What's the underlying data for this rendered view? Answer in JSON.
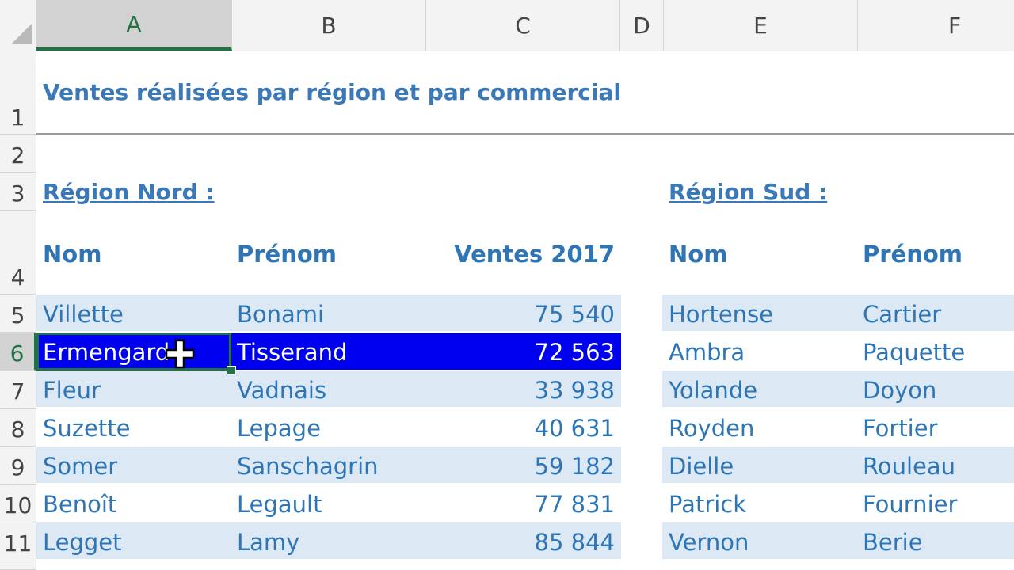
{
  "columns": [
    "A",
    "B",
    "C",
    "D",
    "E",
    "F"
  ],
  "rows": [
    "1",
    "2",
    "3",
    "4",
    "5",
    "6",
    "7",
    "8",
    "9",
    "10",
    "11"
  ],
  "title": "Ventes réalisées par région et par commercial",
  "region_nord": {
    "label": "Région Nord :",
    "headers": {
      "nom": "Nom",
      "prenom": "Prénom",
      "ventes": "Ventes 2017"
    },
    "rows": [
      {
        "nom": "Villette",
        "prenom": "Bonami",
        "ventes": "75 540"
      },
      {
        "nom": "Ermengard",
        "prenom": "Tisserand",
        "ventes": "72 563"
      },
      {
        "nom": "Fleur",
        "prenom": "Vadnais",
        "ventes": "33 938"
      },
      {
        "nom": "Suzette",
        "prenom": "Lepage",
        "ventes": "40 631"
      },
      {
        "nom": "Somer",
        "prenom": "Sanschagrin",
        "ventes": "59 182"
      },
      {
        "nom": "Benoît",
        "prenom": "Legault",
        "ventes": "77 831"
      },
      {
        "nom": "Legget",
        "prenom": "Lamy",
        "ventes": "85 844"
      }
    ]
  },
  "region_sud": {
    "label": "Région Sud :",
    "headers": {
      "nom": "Nom",
      "prenom": "Prénom"
    },
    "rows": [
      {
        "nom": "Hortense",
        "prenom": "Cartier"
      },
      {
        "nom": "Ambra",
        "prenom": "Paquette"
      },
      {
        "nom": "Yolande",
        "prenom": "Doyon"
      },
      {
        "nom": "Royden",
        "prenom": "Fortier"
      },
      {
        "nom": "Dielle",
        "prenom": "Rouleau"
      },
      {
        "nom": "Patrick",
        "prenom": "Fournier"
      },
      {
        "nom": "Vernon",
        "prenom": "Berie"
      }
    ]
  },
  "colors": {
    "text_blue": "#2e75b6",
    "band_blue": "#dce9f5",
    "selection_blue": "#0000f0",
    "excel_green": "#217346"
  },
  "icons": {
    "cursor": "move-cross-cursor-icon",
    "corner": "select-all-triangle-icon"
  }
}
